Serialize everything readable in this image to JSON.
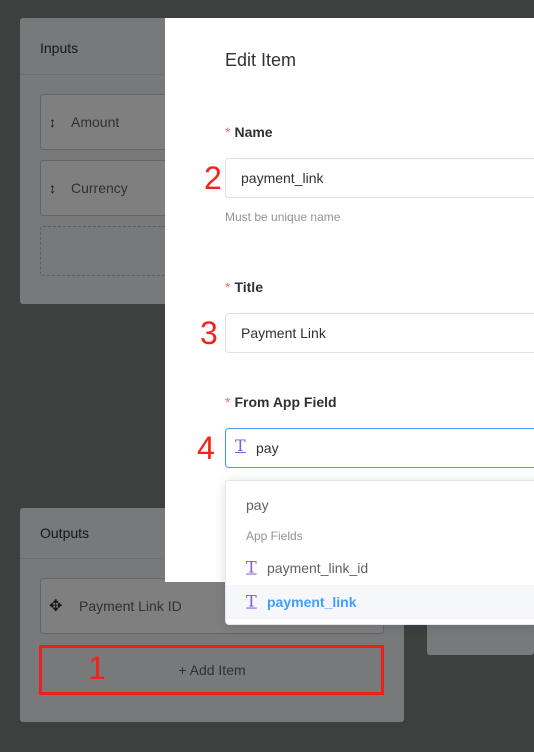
{
  "inputs_panel": {
    "title": "Inputs",
    "items": [
      {
        "icon": "sort-icon",
        "label": "Amount"
      },
      {
        "icon": "sort-icon",
        "label": "Currency"
      }
    ]
  },
  "outputs_panel": {
    "title": "Outputs",
    "items": [
      {
        "icon": "move-icon",
        "label": "Payment Link ID"
      }
    ],
    "add_item_label": "+ Add Item"
  },
  "modal": {
    "title": "Edit Item",
    "required_mark": "*",
    "name": {
      "label": "Name",
      "value": "payment_link",
      "hint": "Must be unique name"
    },
    "title_field": {
      "label": "Title",
      "value": "Payment Link"
    },
    "from_app_field": {
      "label": "From App Field",
      "value": "pay",
      "icon": "text-type-icon"
    }
  },
  "dropdown": {
    "typed_option": "pay",
    "group_label": "App Fields",
    "options": [
      {
        "icon": "text-type-icon",
        "label": "payment_link_id",
        "selected": false
      },
      {
        "icon": "text-type-icon",
        "label": "payment_link",
        "selected": true
      }
    ]
  },
  "annotations": [
    "1",
    "2",
    "3",
    "4"
  ],
  "colors": {
    "required": "#f56c6c",
    "selected_option": "#409eff",
    "annotation": "#f5221b",
    "type_icon": "#7b5cd6"
  }
}
